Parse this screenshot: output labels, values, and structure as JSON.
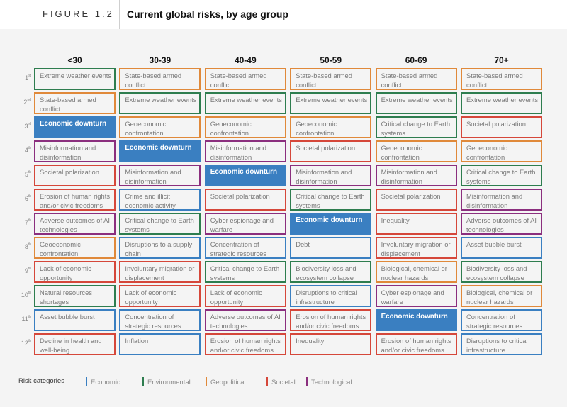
{
  "header": {
    "figure_label": "FIGURE 1.2",
    "title": "Current global risks, by age group"
  },
  "categories": {
    "economic": {
      "label": "Economic",
      "color": "#3a7fc1"
    },
    "environmental": {
      "label": "Environmental",
      "color": "#2e7d4f"
    },
    "geopolitical": {
      "label": "Geopolitical",
      "color": "#e0893a"
    },
    "societal": {
      "label": "Societal",
      "color": "#d5473a"
    },
    "technological": {
      "label": "Technological",
      "color": "#8b2f7e"
    }
  },
  "highlight": {
    "risk": "Economic downturn",
    "fill": "#3a7fc1"
  },
  "ranks": [
    {
      "num": "1",
      "suffix": "st"
    },
    {
      "num": "2",
      "suffix": "nd"
    },
    {
      "num": "3",
      "suffix": "rd"
    },
    {
      "num": "4",
      "suffix": "th"
    },
    {
      "num": "5",
      "suffix": "th"
    },
    {
      "num": "6",
      "suffix": "th"
    },
    {
      "num": "7",
      "suffix": "th"
    },
    {
      "num": "8",
      "suffix": "th"
    },
    {
      "num": "9",
      "suffix": "th"
    },
    {
      "num": "10",
      "suffix": "th"
    },
    {
      "num": "11",
      "suffix": "th"
    },
    {
      "num": "12",
      "suffix": "th"
    }
  ],
  "columns": [
    {
      "age_group": "<30",
      "risks": [
        {
          "label": "Extreme weather events",
          "category": "environmental"
        },
        {
          "label": "State-based armed conflict",
          "category": "geopolitical"
        },
        {
          "label": "Economic downturn",
          "category": "economic",
          "highlight": true
        },
        {
          "label": "Misinformation and disinformation",
          "category": "technological"
        },
        {
          "label": "Societal polarization",
          "category": "societal"
        },
        {
          "label": "Erosion of human rights and/or civic freedoms",
          "category": "societal"
        },
        {
          "label": "Adverse outcomes of AI technologies",
          "category": "technological"
        },
        {
          "label": "Geoeconomic confrontation",
          "category": "geopolitical"
        },
        {
          "label": "Lack of economic opportunity",
          "category": "societal"
        },
        {
          "label": "Natural resources shortages",
          "category": "environmental"
        },
        {
          "label": "Asset bubble burst",
          "category": "economic"
        },
        {
          "label": "Decline in health and well-being",
          "category": "societal"
        }
      ]
    },
    {
      "age_group": "30-39",
      "risks": [
        {
          "label": "State-based armed conflict",
          "category": "geopolitical"
        },
        {
          "label": "Extreme weather events",
          "category": "environmental"
        },
        {
          "label": "Geoeconomic confrontation",
          "category": "geopolitical"
        },
        {
          "label": "Economic downturn",
          "category": "economic",
          "highlight": true
        },
        {
          "label": "Misinformation and disinformation",
          "category": "technological"
        },
        {
          "label": "Crime and illicit economic activity",
          "category": "economic"
        },
        {
          "label": "Critical change to Earth systems",
          "category": "environmental"
        },
        {
          "label": "Disruptions to a supply chain",
          "category": "economic"
        },
        {
          "label": "Involuntary migration or displacement",
          "category": "societal"
        },
        {
          "label": "Lack of economic opportunity",
          "category": "societal"
        },
        {
          "label": "Concentration of strategic resources",
          "category": "economic"
        },
        {
          "label": "Inflation",
          "category": "economic"
        }
      ]
    },
    {
      "age_group": "40-49",
      "risks": [
        {
          "label": "State-based armed conflict",
          "category": "geopolitical"
        },
        {
          "label": "Extreme weather events",
          "category": "environmental"
        },
        {
          "label": "Geoeconomic confrontation",
          "category": "geopolitical"
        },
        {
          "label": "Misinformation and disinformation",
          "category": "technological"
        },
        {
          "label": "Economic downturn",
          "category": "economic",
          "highlight": true
        },
        {
          "label": "Societal polarization",
          "category": "societal"
        },
        {
          "label": "Cyber espionage and warfare",
          "category": "technological"
        },
        {
          "label": "Concentration of strategic resources",
          "category": "economic"
        },
        {
          "label": "Critical change to Earth systems",
          "category": "environmental"
        },
        {
          "label": "Lack of economic opportunity",
          "category": "societal"
        },
        {
          "label": "Adverse outcomes of AI technologies",
          "category": "technological"
        },
        {
          "label": "Erosion of human rights and/or civic freedoms",
          "category": "societal"
        }
      ]
    },
    {
      "age_group": "50-59",
      "risks": [
        {
          "label": "State-based armed conflict",
          "category": "geopolitical"
        },
        {
          "label": "Extreme weather events",
          "category": "environmental"
        },
        {
          "label": "Geoeconomic confrontation",
          "category": "geopolitical"
        },
        {
          "label": "Societal polarization",
          "category": "societal"
        },
        {
          "label": "Misinformation and disinformation",
          "category": "technological"
        },
        {
          "label": "Critical change to Earth systems",
          "category": "environmental"
        },
        {
          "label": "Economic downturn",
          "category": "economic",
          "highlight": true
        },
        {
          "label": "Debt",
          "category": "economic"
        },
        {
          "label": "Biodiversity loss and ecosystem collapse",
          "category": "environmental"
        },
        {
          "label": "Disruptions to critical infrastructure",
          "category": "economic"
        },
        {
          "label": "Erosion of human rights and/or civic freedoms",
          "category": "societal"
        },
        {
          "label": "Inequality",
          "category": "societal"
        }
      ]
    },
    {
      "age_group": "60-69",
      "risks": [
        {
          "label": "State-based armed conflict",
          "category": "geopolitical"
        },
        {
          "label": "Extreme weather events",
          "category": "environmental"
        },
        {
          "label": "Critical change to Earth systems",
          "category": "environmental"
        },
        {
          "label": "Geoeconomic confrontation",
          "category": "geopolitical"
        },
        {
          "label": "Misinformation and disinformation",
          "category": "technological"
        },
        {
          "label": "Societal polarization",
          "category": "societal"
        },
        {
          "label": "Inequality",
          "category": "societal"
        },
        {
          "label": "Involuntary migration or displacement",
          "category": "societal"
        },
        {
          "label": "Biological, chemical or nuclear hazards",
          "category": "geopolitical"
        },
        {
          "label": "Cyber espionage and warfare",
          "category": "technological"
        },
        {
          "label": "Economic downturn",
          "category": "economic",
          "highlight": true
        },
        {
          "label": "Erosion of human rights and/or civic freedoms",
          "category": "societal"
        }
      ]
    },
    {
      "age_group": "70+",
      "risks": [
        {
          "label": "State-based armed conflict",
          "category": "geopolitical"
        },
        {
          "label": "Extreme weather events",
          "category": "environmental"
        },
        {
          "label": "Societal polarization",
          "category": "societal"
        },
        {
          "label": "Geoeconomic confrontation",
          "category": "geopolitical"
        },
        {
          "label": "Critical change to Earth systems",
          "category": "environmental"
        },
        {
          "label": "Misinformation and disinformation",
          "category": "technological"
        },
        {
          "label": "Adverse outcomes of AI technologies",
          "category": "technological"
        },
        {
          "label": "Asset bubble burst",
          "category": "economic"
        },
        {
          "label": "Biodiversity loss and ecosystem collapse",
          "category": "environmental"
        },
        {
          "label": "Biological, chemical or nuclear hazards",
          "category": "geopolitical"
        },
        {
          "label": "Concentration of strategic resources",
          "category": "economic"
        },
        {
          "label": "Disruptions to critical infrastructure",
          "category": "economic"
        }
      ]
    }
  ],
  "legend": {
    "title": "Risk categories",
    "items": [
      "economic",
      "environmental",
      "geopolitical",
      "societal",
      "technological"
    ]
  }
}
